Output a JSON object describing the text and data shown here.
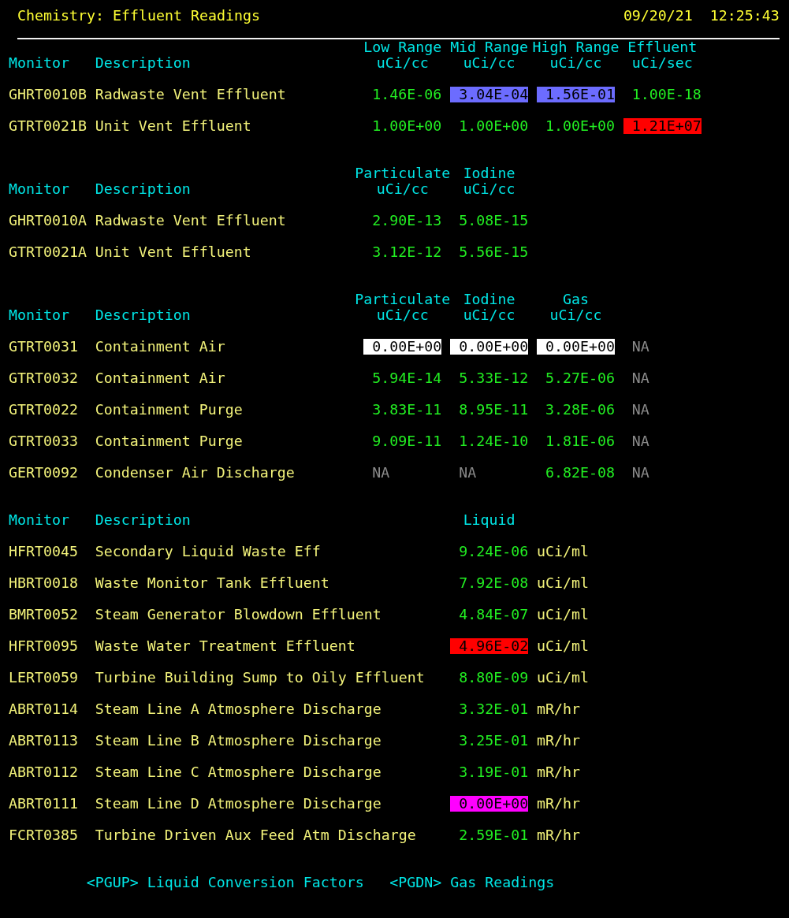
{
  "header": {
    "title": "Chemistry: Effluent Readings",
    "date": "09/20/21",
    "time": "12:25:43"
  },
  "sections": [
    {
      "kind": "monitors",
      "monitor_label": "Monitor",
      "description_label": "Description",
      "columns": [
        {
          "title": "Low Range",
          "unit": "uCi/cc"
        },
        {
          "title": "Mid Range",
          "unit": "uCi/cc"
        },
        {
          "title": "High Range",
          "unit": "uCi/cc"
        },
        {
          "title": "Effluent",
          "unit": "uCi/sec"
        }
      ],
      "rows": [
        {
          "monitor": "GHRT0010B",
          "description": "Radwaste Vent Effluent",
          "values": [
            {
              "text": "1.46E-06",
              "kind": "reading"
            },
            {
              "text": "3.04E-04",
              "kind": "reading",
              "color": "#6c6cff"
            },
            {
              "text": "1.56E-01",
              "kind": "reading",
              "color": "#6c6cff"
            },
            {
              "text": "1.00E-18",
              "kind": "reading"
            }
          ]
        },
        {
          "monitor": "GTRT0021B",
          "description": "Unit Vent Effluent",
          "values": [
            {
              "text": "1.00E+00",
              "kind": "reading"
            },
            {
              "text": "1.00E+00",
              "kind": "reading"
            },
            {
              "text": "1.00E+00",
              "kind": "reading"
            },
            {
              "text": "1.21E+07",
              "kind": "reading",
              "color": "#ff0000"
            }
          ]
        }
      ]
    },
    {
      "kind": "monitors",
      "monitor_label": "Monitor",
      "description_label": "Description",
      "columns": [
        {
          "title": "Particulate",
          "unit": "uCi/cc"
        },
        {
          "title": "Iodine",
          "unit": "uCi/cc"
        }
      ],
      "rows": [
        {
          "monitor": "GHRT0010A",
          "description": "Radwaste Vent Effluent",
          "values": [
            {
              "text": "2.90E-13",
              "kind": "reading"
            },
            {
              "text": "5.08E-15",
              "kind": "reading"
            }
          ]
        },
        {
          "monitor": "GTRT0021A",
          "description": "Unit Vent Effluent",
          "values": [
            {
              "text": "3.12E-12",
              "kind": "reading"
            },
            {
              "text": "5.56E-15",
              "kind": "reading"
            }
          ]
        }
      ]
    },
    {
      "kind": "monitors",
      "monitor_label": "Monitor",
      "description_label": "Description",
      "columns": [
        {
          "title": "Particulate",
          "unit": "uCi/cc"
        },
        {
          "title": "Iodine",
          "unit": "uCi/cc"
        },
        {
          "title": "Gas",
          "unit": "uCi/cc"
        }
      ],
      "rows": [
        {
          "monitor": "GTRT0031",
          "description": "Containment Air",
          "values": [
            {
              "text": "0.00E+00",
              "kind": "reading",
              "color": "#ffffff"
            },
            {
              "text": "0.00E+00",
              "kind": "reading",
              "color": "#ffffff"
            },
            {
              "text": "0.00E+00",
              "kind": "reading",
              "color": "#ffffff"
            },
            {
              "text": "NA",
              "kind": "na"
            }
          ]
        },
        {
          "monitor": "GTRT0032",
          "description": "Containment Air",
          "values": [
            {
              "text": "5.94E-14",
              "kind": "reading"
            },
            {
              "text": "5.33E-12",
              "kind": "reading"
            },
            {
              "text": "5.27E-06",
              "kind": "reading"
            },
            {
              "text": "NA",
              "kind": "na"
            }
          ]
        },
        {
          "monitor": "GTRT0022",
          "description": "Containment Purge",
          "values": [
            {
              "text": "3.83E-11",
              "kind": "reading"
            },
            {
              "text": "8.95E-11",
              "kind": "reading"
            },
            {
              "text": "3.28E-06",
              "kind": "reading"
            },
            {
              "text": "NA",
              "kind": "na"
            }
          ]
        },
        {
          "monitor": "GTRT0033",
          "description": "Containment Purge",
          "values": [
            {
              "text": "9.09E-11",
              "kind": "reading"
            },
            {
              "text": "1.24E-10",
              "kind": "reading"
            },
            {
              "text": "1.81E-06",
              "kind": "reading"
            },
            {
              "text": "NA",
              "kind": "na"
            }
          ]
        },
        {
          "monitor": "GERT0092",
          "description": "Condenser Air Discharge",
          "values": [
            {
              "text": "NA",
              "kind": "na"
            },
            {
              "text": "NA",
              "kind": "na"
            },
            {
              "text": "6.82E-08",
              "kind": "reading"
            },
            {
              "text": "NA",
              "kind": "na"
            }
          ]
        }
      ]
    },
    {
      "kind": "liquid",
      "monitor_label": "Monitor",
      "description_label": "Description",
      "columns": [
        {
          "title": "Liquid"
        }
      ],
      "rows": [
        {
          "monitor": "HFRT0045",
          "description": "Secondary Liquid Waste Eff",
          "values": [
            {
              "text": "9.24E-06",
              "kind": "reading"
            }
          ],
          "unit": "uCi/ml"
        },
        {
          "monitor": "HBRT0018",
          "description": "Waste Monitor Tank Effluent",
          "values": [
            {
              "text": "7.92E-08",
              "kind": "reading"
            }
          ],
          "unit": "uCi/ml"
        },
        {
          "monitor": "BMRT0052",
          "description": "Steam Generator Blowdown Effluent",
          "values": [
            {
              "text": "4.84E-07",
              "kind": "reading"
            }
          ],
          "unit": "uCi/ml"
        },
        {
          "monitor": "HFRT0095",
          "description": "Waste Water Treatment Effluent",
          "values": [
            {
              "text": "4.96E-02",
              "kind": "reading",
              "color": "#ff0000"
            }
          ],
          "unit": "uCi/ml"
        },
        {
          "monitor": "LERT0059",
          "description": "Turbine Building Sump to Oily Effluent",
          "values": [
            {
              "text": "8.80E-09",
              "kind": "reading"
            }
          ],
          "unit": "uCi/ml"
        }
      ]
    },
    {
      "kind": "liquid",
      "rows": [
        {
          "monitor": "ABRT0114",
          "description": "Steam Line A Atmosphere Discharge",
          "values": [
            {
              "text": "3.32E-01",
              "kind": "reading"
            }
          ],
          "unit": "mR/hr"
        },
        {
          "monitor": "ABRT0113",
          "description": "Steam Line B Atmosphere Discharge",
          "values": [
            {
              "text": "3.25E-01",
              "kind": "reading"
            }
          ],
          "unit": "mR/hr"
        },
        {
          "monitor": "ABRT0112",
          "description": "Steam Line C Atmosphere Discharge",
          "values": [
            {
              "text": "3.19E-01",
              "kind": "reading"
            }
          ],
          "unit": "mR/hr"
        },
        {
          "monitor": "ABRT0111",
          "description": "Steam Line D Atmosphere Discharge",
          "values": [
            {
              "text": "0.00E+00",
              "kind": "reading",
              "color": "#ff00ff"
            }
          ],
          "unit": "mR/hr"
        },
        {
          "monitor": "FCRT0385",
          "description": "Turbine Driven Aux Feed Atm Discharge",
          "values": [
            {
              "text": "2.59E-01",
              "kind": "reading"
            }
          ],
          "unit": "mR/hr"
        }
      ]
    }
  ],
  "footer": [
    {
      "text": "<PGUP> Liquid Conversion Factors"
    },
    {
      "text": "<PGDN> Gas Readings"
    }
  ]
}
